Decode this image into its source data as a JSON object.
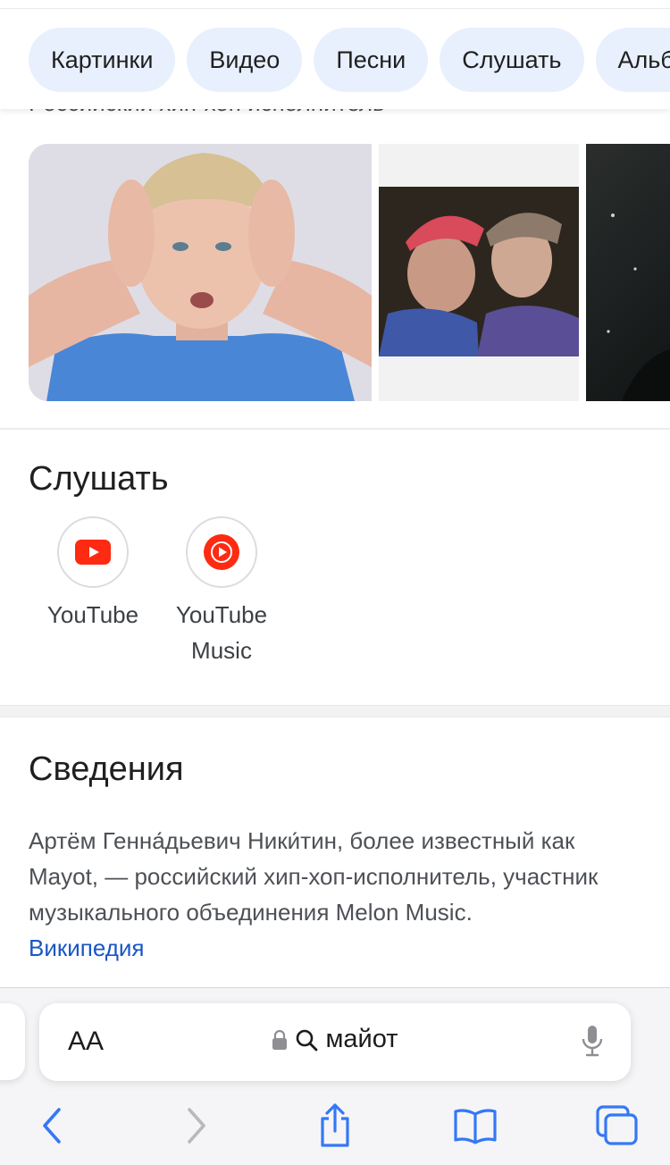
{
  "chips": [
    "Картинки",
    "Видео",
    "Песни",
    "Слушать",
    "Альбомы"
  ],
  "kp_subtitle": "Российский хип-хоп исполнитель",
  "listen": {
    "title": "Слушать",
    "services": [
      {
        "name": "YouTube",
        "icon": "youtube-icon",
        "color": "#ff0000"
      },
      {
        "name": "YouTube Music",
        "icon": "youtube-music-icon",
        "color": "#ff0000"
      }
    ]
  },
  "about": {
    "title": "Сведения",
    "text": "Артём Генна́дьевич Ники́тин, более известный как Mayot, — российский хип-хоп-исполнитель, участник музыкального объединения Melon Music.",
    "source_link": "Википедия"
  },
  "browser": {
    "text_size_label": "AA",
    "address_text": "майот",
    "accent": "#3478f6"
  }
}
